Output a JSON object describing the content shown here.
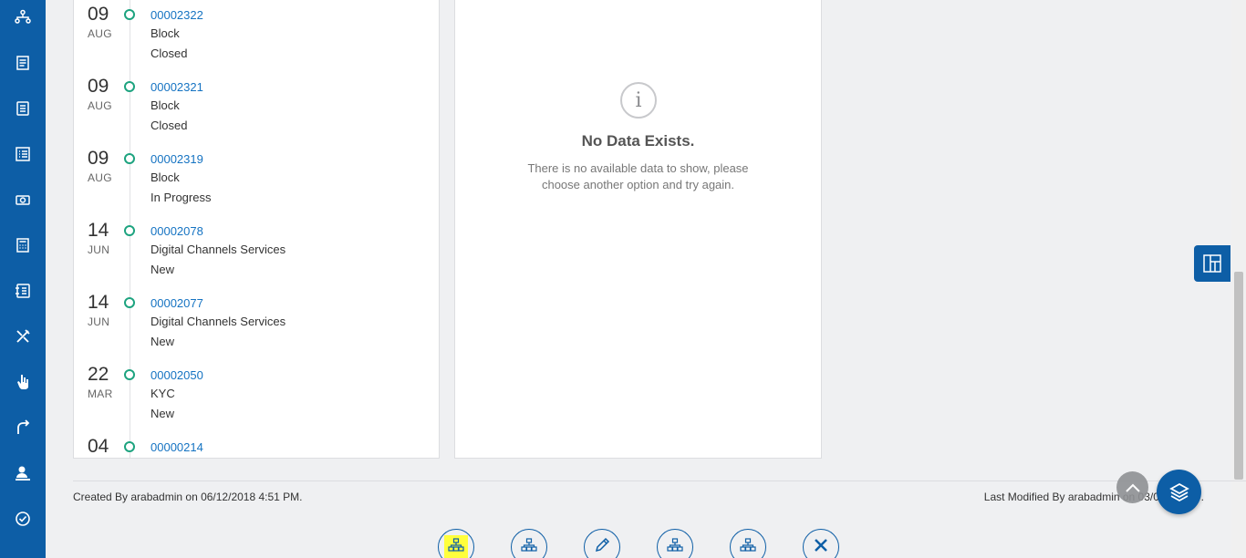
{
  "sidebar": {
    "icons": [
      "org-chart-icon",
      "document-icon",
      "notes-icon",
      "list-icon",
      "camera-icon",
      "calculator-icon",
      "checklist-icon",
      "tools-icon",
      "hand-pointer-icon",
      "route-icon",
      "user-desk-icon",
      "check-circle-icon"
    ]
  },
  "timeline": {
    "items": [
      {
        "day": "09",
        "month": "AUG",
        "id": "00002322",
        "type": "Block",
        "status": "Closed"
      },
      {
        "day": "09",
        "month": "AUG",
        "id": "00002321",
        "type": "Block",
        "status": "Closed"
      },
      {
        "day": "09",
        "month": "AUG",
        "id": "00002319",
        "type": "Block",
        "status": "In Progress"
      },
      {
        "day": "14",
        "month": "JUN",
        "id": "00002078",
        "type": "Digital Channels Services",
        "status": "New"
      },
      {
        "day": "14",
        "month": "JUN",
        "id": "00002077",
        "type": "Digital Channels Services",
        "status": "New"
      },
      {
        "day": "22",
        "month": "MAR",
        "id": "00002050",
        "type": "KYC",
        "status": "New"
      },
      {
        "day": "04",
        "month": "",
        "id": "00000214",
        "type": "",
        "status": ""
      }
    ]
  },
  "no_data": {
    "icon": "info-icon",
    "glyph": "i",
    "title": "No Data Exists.",
    "message": "There is no available data to show, please choose another option and try again."
  },
  "footer": {
    "created": "Created By arabadmin on 06/12/2018 4:51 PM.",
    "modified": "Last Modified By arabadmin on 03/0 2022 ... ."
  },
  "actions": [
    {
      "name": "hierarchy-action-1",
      "icon": "org-chart-icon",
      "highlighted": true
    },
    {
      "name": "hierarchy-action-2",
      "icon": "org-chart-icon",
      "highlighted": false
    },
    {
      "name": "edit-action",
      "icon": "pencil-icon",
      "highlighted": false
    },
    {
      "name": "hierarchy-action-3",
      "icon": "org-chart-icon",
      "highlighted": false
    },
    {
      "name": "hierarchy-action-4",
      "icon": "org-chart-icon",
      "highlighted": false
    },
    {
      "name": "close-action",
      "icon": "close-icon",
      "highlighted": false
    }
  ],
  "colors": {
    "brand": "#0d5ea6",
    "link": "#1573c2",
    "timeline_dot": "#1da37f",
    "highlight": "#ffff3c"
  }
}
